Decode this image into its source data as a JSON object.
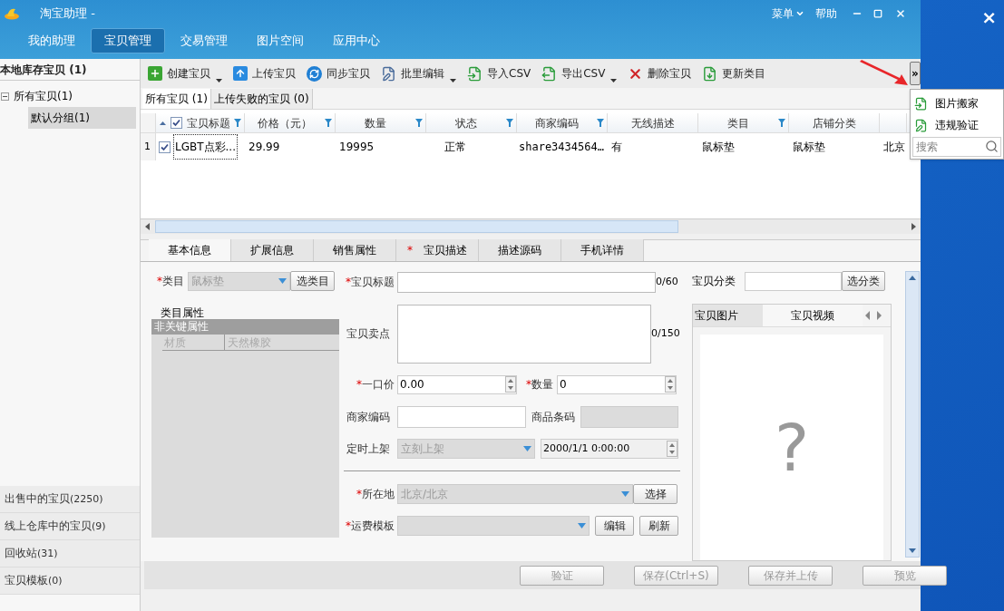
{
  "window": {
    "title": "淘宝助理 -",
    "menu": "菜单",
    "help": "帮助"
  },
  "desktop": {
    "close": "×"
  },
  "nav_tabs": [
    {
      "label": "我的助理",
      "selected": false
    },
    {
      "label": "宝贝管理",
      "selected": true
    },
    {
      "label": "交易管理",
      "selected": false
    },
    {
      "label": "图片空间",
      "selected": false
    },
    {
      "label": "应用中心",
      "selected": false
    }
  ],
  "sidebar": {
    "header": "本地库存宝贝 (1)",
    "tree": [
      {
        "label": "所有宝贝(1)",
        "expanded": true,
        "selected": false,
        "children": [
          {
            "label": "默认分组(1)",
            "selected": true
          }
        ]
      }
    ],
    "bottom_items": [
      {
        "label": "出售中的宝贝",
        "count": "(2250)"
      },
      {
        "label": "线上仓库中的宝贝",
        "count": "(9)"
      },
      {
        "label": "回收站",
        "count": "(31)"
      },
      {
        "label": "宝贝模板",
        "count": "(0)"
      }
    ]
  },
  "toolbar": {
    "items": [
      {
        "label": "创建宝贝",
        "dropdown": true
      },
      {
        "label": "上传宝贝",
        "dropdown": false
      },
      {
        "label": "同步宝贝",
        "dropdown": false
      },
      {
        "label": "批里编辑",
        "dropdown": true
      },
      {
        "label": "导入CSV",
        "dropdown": false
      },
      {
        "label": "导出CSV",
        "dropdown": true
      },
      {
        "label": "删除宝贝",
        "dropdown": false
      },
      {
        "label": "更新类目",
        "dropdown": false
      }
    ],
    "overflow": "»",
    "overflow_menu": {
      "items": [
        "图片搬家",
        "违规验证"
      ],
      "search_placeholder": "搜索"
    }
  },
  "list_tabs": [
    {
      "label": "所有宝贝 (1)",
      "selected": true
    },
    {
      "label": "上传失败的宝贝 (0)",
      "selected": false
    }
  ],
  "table": {
    "all_checked": true,
    "columns": [
      {
        "label": "宝贝标题",
        "filter": true
      },
      {
        "label": "价格（元）",
        "filter": true
      },
      {
        "label": "数量",
        "filter": true
      },
      {
        "label": "状态",
        "filter": true
      },
      {
        "label": "商家编码",
        "filter": true
      },
      {
        "label": "无线描述",
        "filter": false
      },
      {
        "label": "类目",
        "filter": true
      },
      {
        "label": "店铺分类",
        "filter": false
      }
    ],
    "rows": [
      {
        "number": "1",
        "checked": true,
        "cells": [
          "LGBT点彩...",
          "29.99",
          "19995",
          "正常",
          "share3434564…",
          "有",
          "鼠标垫",
          "鼠标垫",
          "北京"
        ]
      }
    ]
  },
  "form_tabs": [
    {
      "label": "基本信息",
      "selected": true
    },
    {
      "label": "扩展信息",
      "selected": false
    },
    {
      "label": "销售属性",
      "selected": false
    },
    {
      "label": "宝贝描述",
      "selected": false,
      "mark": "*"
    },
    {
      "label": "描述源码",
      "selected": false
    },
    {
      "label": "手机详情",
      "selected": false
    }
  ],
  "form": {
    "category": {
      "label": "类目",
      "mark": "*",
      "value": "鼠标垫",
      "disabled": true,
      "button": "选类目"
    },
    "attributes": {
      "legend": "类目属性",
      "group": "非关键属性",
      "rows": [
        {
          "name": "材质",
          "value": "天然橡胶"
        }
      ]
    },
    "title": {
      "label": "宝贝标题",
      "mark": "*",
      "counter": "0/60"
    },
    "selling_point": {
      "label": "宝贝卖点",
      "counter": "0/150"
    },
    "price": {
      "label": "一口价",
      "mark": "*",
      "value": "0.00"
    },
    "quantity": {
      "label": "数量",
      "mark": "*",
      "value": "0"
    },
    "merchant_code": {
      "label": "商家编码"
    },
    "barcode": {
      "label": "商品条码"
    },
    "schedule": {
      "label": "定时上架",
      "value": "立刻上架",
      "disabled": true,
      "datetime": "2000/1/1 0:00:00"
    },
    "location": {
      "label": "所在地",
      "mark": "*",
      "value": "北京/北京",
      "disabled": true,
      "button": "选择"
    },
    "shipping": {
      "label": "运费模板",
      "mark": "*",
      "buttons": [
        "编辑",
        "刷新"
      ]
    },
    "shop_category": {
      "label": "宝贝分类",
      "button": "选分类"
    },
    "media_tabs": [
      {
        "label": "宝贝图片",
        "selected": false
      },
      {
        "label": "宝贝视频",
        "selected": true
      }
    ],
    "media_placeholder": "?"
  },
  "actions": [
    {
      "label": "验证",
      "disabled": true
    },
    {
      "label": "保存(Ctrl+S)",
      "disabled": true
    },
    {
      "label": "保存并上传",
      "disabled": true
    },
    {
      "label": "预览",
      "disabled": true
    }
  ]
}
